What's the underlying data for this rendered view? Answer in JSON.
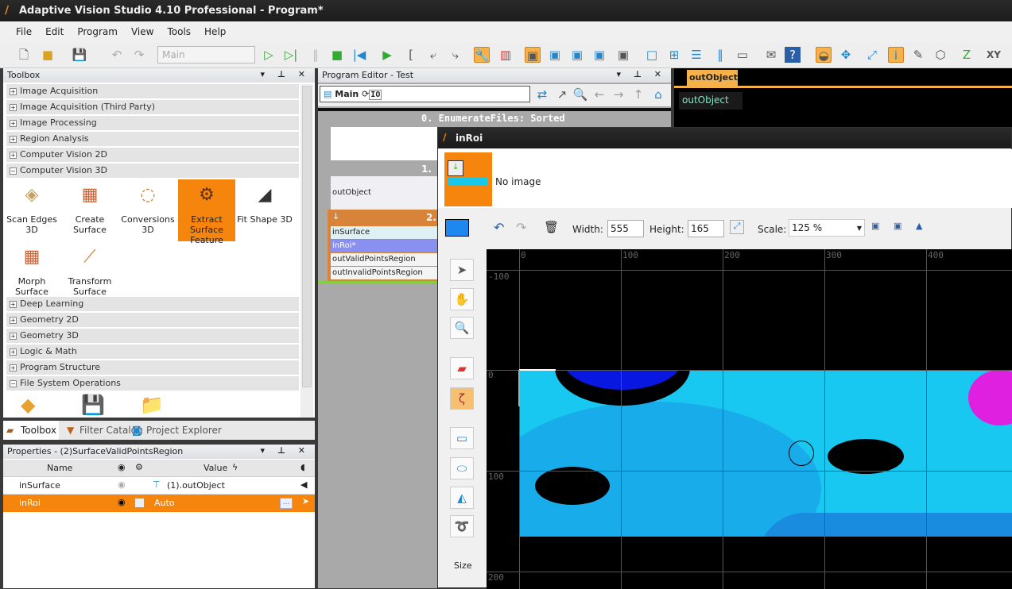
{
  "app": {
    "title": "Adaptive Vision Studio 4.10 Professional - Program*"
  },
  "menu": [
    "File",
    "Edit",
    "Program",
    "View",
    "Tools",
    "Help"
  ],
  "toolbar": {
    "program_combo": "Main"
  },
  "toolbox": {
    "title": "Toolbox",
    "categories_top": [
      {
        "label": "Image Acquisition",
        "state": "+"
      },
      {
        "label": "Image Acquisition (Third Party)",
        "state": "+"
      },
      {
        "label": "Image Processing",
        "state": "+"
      },
      {
        "label": "Region Analysis",
        "state": "+"
      },
      {
        "label": "Computer Vision 2D",
        "state": "+"
      },
      {
        "label": "Computer Vision 3D",
        "state": "−"
      }
    ],
    "tools_3d": [
      {
        "label": "Scan Edges 3D",
        "icon": "scan-edges-icon"
      },
      {
        "label": "Create Surface",
        "icon": "grid-icon"
      },
      {
        "label": "Conversions 3D",
        "icon": "conversion-icon"
      },
      {
        "label": "Extract Surface Feature",
        "icon": "extract-icon"
      },
      {
        "label": "Fit Shape 3D",
        "icon": "fit-shape-icon"
      },
      {
        "label": "Morph Surface",
        "icon": "grid-icon"
      },
      {
        "label": "Transform Surface",
        "icon": "transform-icon"
      }
    ],
    "categories_bottom": [
      {
        "label": "Deep Learning",
        "state": "+"
      },
      {
        "label": "Geometry 2D",
        "state": "+"
      },
      {
        "label": "Geometry 3D",
        "state": "+"
      },
      {
        "label": "Logic & Math",
        "state": "+"
      },
      {
        "label": "Program Structure",
        "state": "+"
      },
      {
        "label": "File System Operations",
        "state": "−"
      }
    ]
  },
  "panel_tabs": [
    "Toolbox",
    "Filter Catalog",
    "Project Explorer"
  ],
  "properties": {
    "title": "Properties - (2)SurfaceValidPointsRegion",
    "columns": {
      "name": "Name",
      "value": "Value"
    },
    "rows": [
      {
        "name": "inSurface",
        "value": "(1).outObject"
      },
      {
        "name": "inRoi",
        "value": "Auto",
        "button": "..."
      }
    ]
  },
  "editor": {
    "title": "Program Editor - Test",
    "macro": "Main",
    "io": "IO",
    "step0": "0. EnumerateFiles: Sorted",
    "step1": "1.",
    "step2": "2.",
    "ports1": [
      "outObject"
    ],
    "ports2": [
      "inSurface",
      "inRoi*",
      "outValidPointsRegion",
      "outInvalidPointsRegion"
    ]
  },
  "viewer": {
    "tab": "outObject",
    "item": "outObject"
  },
  "dialog": {
    "title": "inRoi",
    "no_image": "No image",
    "width_label": "Width:",
    "width": "555",
    "height_label": "Height:",
    "height": "165",
    "scale_label": "Scale:",
    "scale": "125 %",
    "size_label": "Size",
    "x_ticks": [
      "0",
      "100",
      "200",
      "300",
      "400"
    ],
    "y_ticks": [
      "-100",
      "0",
      "100",
      "200"
    ],
    "colors": {
      "accent": "#f5850c",
      "fill": "#1e88f0"
    }
  }
}
